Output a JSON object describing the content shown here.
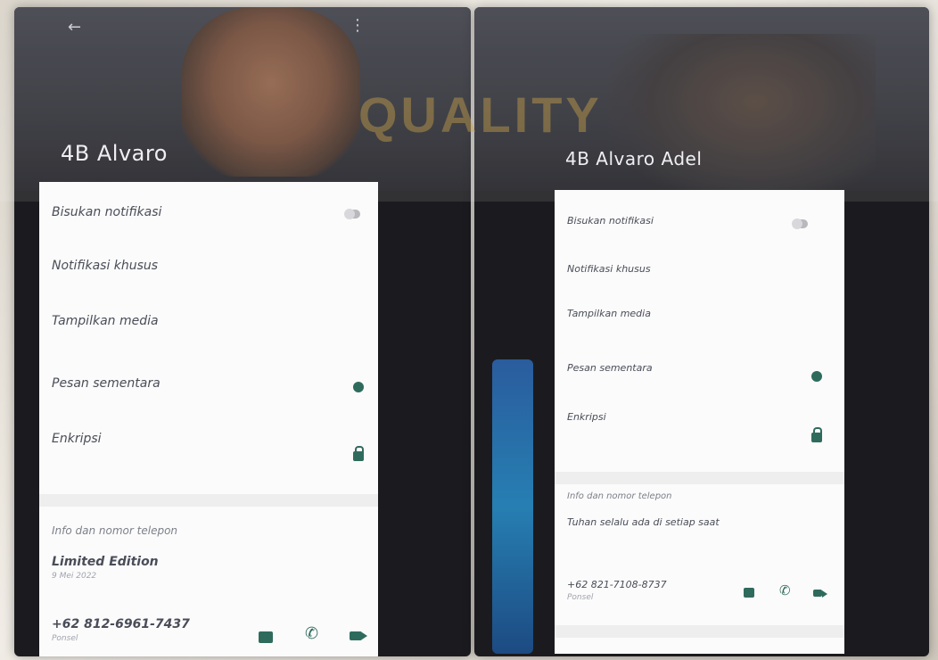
{
  "watermark": {
    "text": "QUALITY"
  },
  "left": {
    "contact_name": "4B Alvaro",
    "menu": {
      "mute": "Bisukan notifikasi",
      "custom": "Notifikasi khusus",
      "media": "Tampilkan media",
      "disappearing": "Pesan sementara",
      "encryption": "Enkripsi"
    },
    "info_section": "Info dan nomor telepon",
    "about": {
      "status": "Limited Edition",
      "date": "9 Mei 2022"
    },
    "phone": {
      "number": "+62 812-6961-7437",
      "type": "Ponsel"
    }
  },
  "right": {
    "contact_name": "4B Alvaro Adel",
    "menu": {
      "mute": "Bisukan notifikasi",
      "custom": "Notifikasi khusus",
      "media": "Tampilkan media",
      "disappearing": "Pesan sementara",
      "encryption": "Enkripsi"
    },
    "info_section": "Info dan nomor telepon",
    "about": {
      "status": "Tuhan selalu ada di setiap saat"
    },
    "phone": {
      "number": "+62 821-7108-8737",
      "type": "Ponsel"
    }
  },
  "colors": {
    "accent": "#2f6b5d",
    "card": "#fbfbfb",
    "header": "#2b2c33"
  }
}
